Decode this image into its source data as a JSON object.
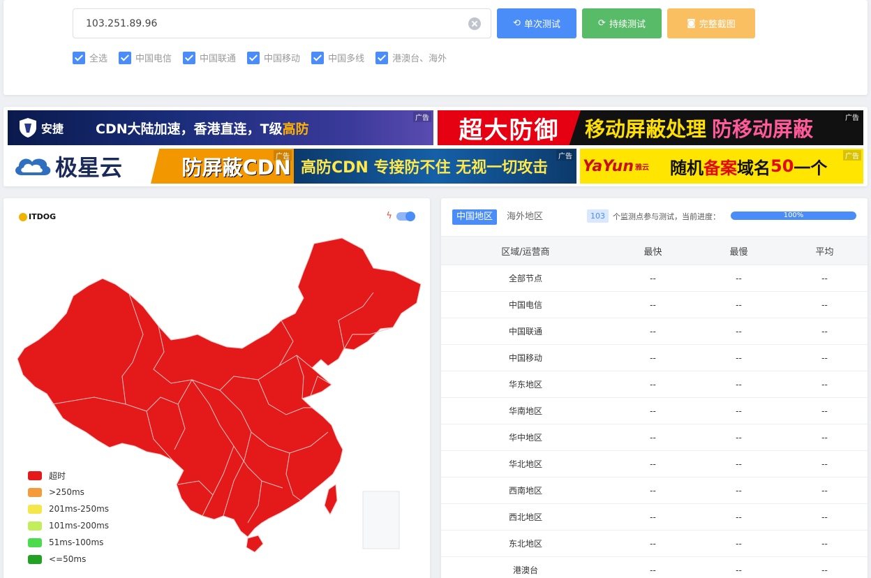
{
  "form": {
    "ip_value": "103.251.89.96",
    "btn_single": "单次测试",
    "btn_continuous": "持续测试",
    "btn_screenshot": "完整截图",
    "checkboxes": [
      "全选",
      "中国电信",
      "中国联通",
      "中国移动",
      "中国多线",
      "港澳台、海外"
    ]
  },
  "ads": {
    "tag": "广告",
    "ad1_brand": "安捷",
    "ad1_text": "CDN大陆加速，香港直连，T级",
    "ad1_highlight": "高防",
    "ad2_text1": "超大防御",
    "ad2_text2": "移动屏蔽处理",
    "ad2_text3": "防移动屏蔽",
    "ad3_brand": "极星云",
    "ad3_text": "防屏蔽CDN",
    "ad4_text": "高防CDN 专接防不住 无视一切攻击",
    "ad5_brand": "YaYun",
    "ad5_brand_sub": "雅云",
    "ad5_text1": "随机",
    "ad5_text2": "备案",
    "ad5_text3": "域名",
    "ad5_text4": "50",
    "ad5_text5": "一个"
  },
  "map": {
    "logo": "ITDOG",
    "legend": [
      {
        "label": "超时",
        "color": "#e3191a"
      },
      {
        "label": ">250ms",
        "color": "#f39c3c"
      },
      {
        "label": "201ms-250ms",
        "color": "#f5e74a"
      },
      {
        "label": "101ms-200ms",
        "color": "#c3ee5b"
      },
      {
        "label": "51ms-100ms",
        "color": "#4cdb4c"
      },
      {
        "label": "<=50ms",
        "color": "#23a123"
      }
    ],
    "fill_color": "#e3191a"
  },
  "results": {
    "tab_china": "中国地区",
    "tab_overseas": "海外地区",
    "node_count": "103",
    "progress_text": "个监测点参与测试，当前进度：",
    "progress_percent": 100,
    "progress_label": "100%",
    "columns": [
      "区域/运营商",
      "最快",
      "最慢",
      "平均"
    ],
    "rows": [
      [
        "全部节点",
        "--",
        "--",
        "--"
      ],
      [
        "中国电信",
        "--",
        "--",
        "--"
      ],
      [
        "中国联通",
        "--",
        "--",
        "--"
      ],
      [
        "中国移动",
        "--",
        "--",
        "--"
      ],
      [
        "华东地区",
        "--",
        "--",
        "--"
      ],
      [
        "华南地区",
        "--",
        "--",
        "--"
      ],
      [
        "华中地区",
        "--",
        "--",
        "--"
      ],
      [
        "华北地区",
        "--",
        "--",
        "--"
      ],
      [
        "西南地区",
        "--",
        "--",
        "--"
      ],
      [
        "西北地区",
        "--",
        "--",
        "--"
      ],
      [
        "东北地区",
        "--",
        "--",
        "--"
      ],
      [
        "港澳台",
        "--",
        "--",
        "--"
      ]
    ]
  }
}
